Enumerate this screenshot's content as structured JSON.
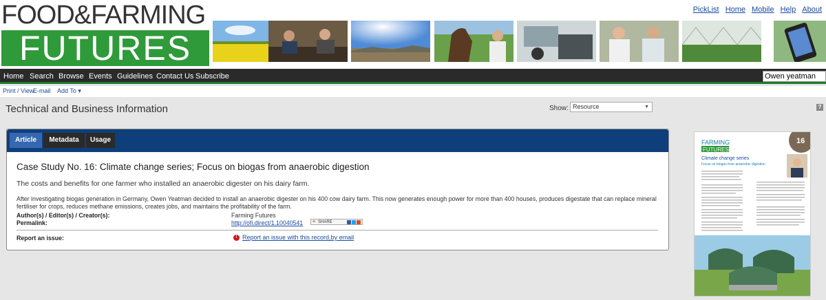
{
  "logo": {
    "line1": "FOOD&FARMING",
    "line2": "FUTURES"
  },
  "toplinks": [
    "PickList",
    "Home",
    "Mobile",
    "Help",
    "About"
  ],
  "nav": [
    "Home",
    "Search",
    "Browse",
    "Events",
    "Guidelines",
    "Contact Us",
    "Subscribe"
  ],
  "search": {
    "value": "Owen yeatman"
  },
  "subbar": {
    "print": "Print / View",
    "email": "E-mail",
    "addto": "Add To ▾"
  },
  "page": {
    "title": "Technical and Business Information"
  },
  "show": {
    "label": "Show:",
    "value": "Resource"
  },
  "tabs": [
    "Article",
    "Metadata",
    "Usage"
  ],
  "article": {
    "title": "Case Study No. 16: Climate change series; Focus on biogas from anaerobic digestion",
    "description": "The costs and benefits for one farmer who installed an anaerobic digester on his dairy farm.",
    "body": "After investigating biogas generation in Germany, Owen Yeatman decided to install an anaerobic digester on his 400 cow dairy farm.  This now generates enough power for more than 400 houses, produces digestate that can replace mineral fertiliser for crops, reduces methane emissions, creates jobs, and maintains the profitability of the farm."
  },
  "meta": {
    "author_label": "Author(s) / Editor(s) / Creator(s):",
    "author_value": "Farming Futures",
    "permalink_label": "Permalink:",
    "permalink_value": "http://ofi.direct/1.10040541",
    "share_label": "SHARE",
    "report_label": "Report an issue:",
    "report_link": "Report an issue with this record,by email"
  },
  "thumb": {
    "brand1": "FARMING",
    "brand2": "FUTURES",
    "number": "16",
    "series": "Climate change series",
    "subtitle": "Focus on biogas from anaerobic digestion"
  },
  "colors": {
    "green": "#2f9a3a",
    "nav": "#2a2a2a",
    "tabbar": "#0f3f7a",
    "link": "#1a4aa0"
  }
}
